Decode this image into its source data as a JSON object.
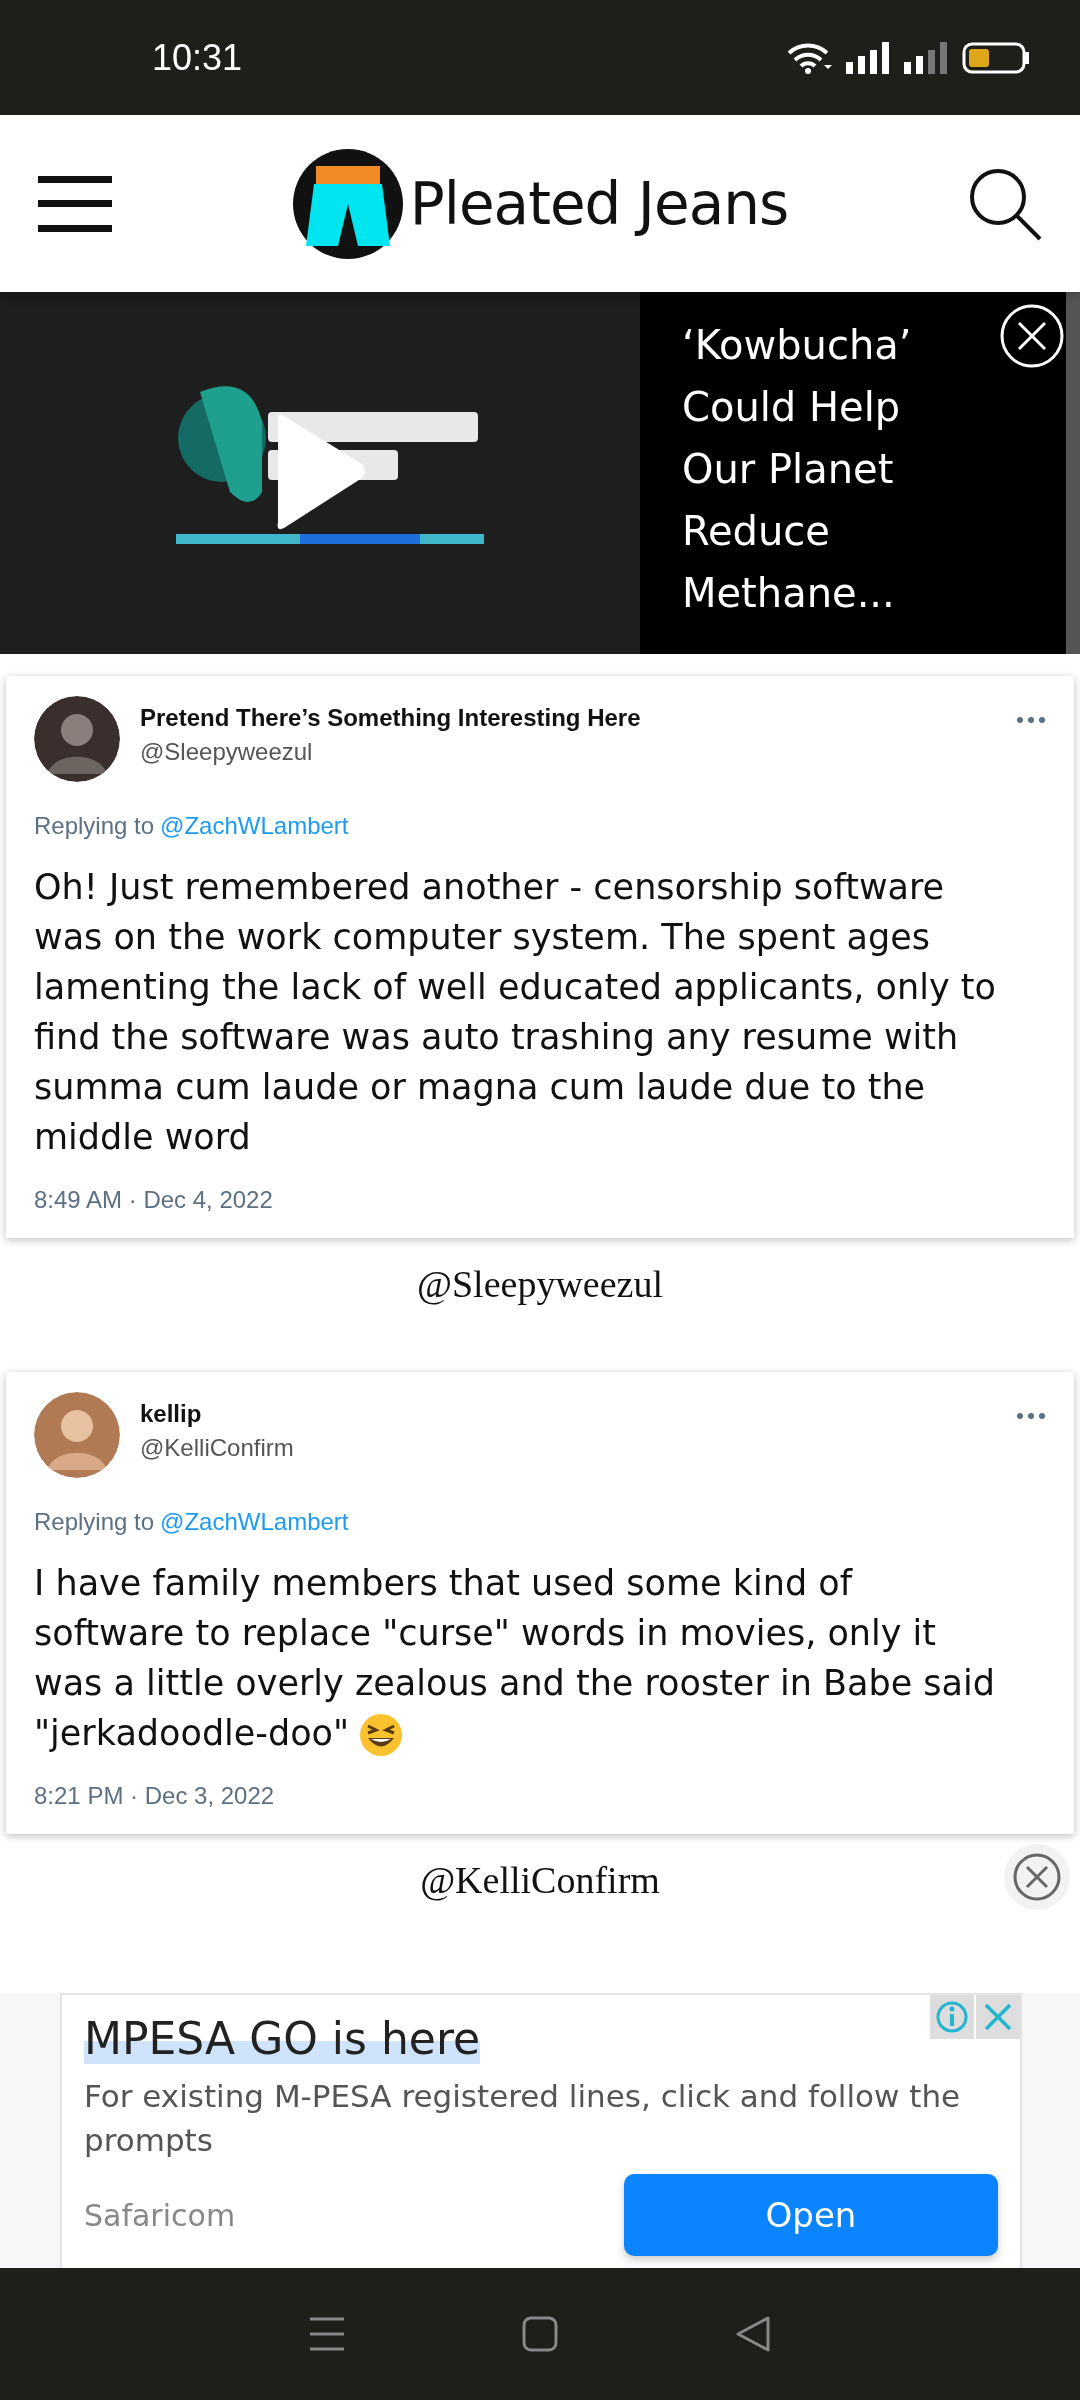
{
  "status_bar": {
    "time": "10:31"
  },
  "header": {
    "site_name": "Pleated Jeans"
  },
  "video": {
    "headline": "‘Kowbucha’ Could Help Our Planet Reduce Methane..."
  },
  "tweets": [
    {
      "name": "Pretend There’s Something Interesting Here",
      "handle": "@Sleepyweezul",
      "replying_label": "Replying to",
      "reply_to": "@ZachWLambert",
      "text": "Oh! Just remembered another - censorship software was on the work computer system. The spent ages lamenting the lack of well educated applicants, only to find the software was auto trashing any resume with summa cum laude or magna cum laude due to the middle word",
      "has_emoji": false,
      "timestamp": "8:49 AM · Dec 4, 2022",
      "caption": "@Sleepyweezul"
    },
    {
      "name": "kellip",
      "handle": "@KelliConfirm",
      "replying_label": "Replying to",
      "reply_to": "@ZachWLambert",
      "text": "I have family members that used some kind of software to replace \"curse\" words in movies, only it was a little overly zealous and the rooster in Babe said \"jerkadoodle-doo\"",
      "has_emoji": true,
      "timestamp": "8:21 PM · Dec 3, 2022",
      "caption": "@KelliConfirm"
    }
  ],
  "ad": {
    "title": "MPESA GO is here",
    "description": "For existing M-PESA registered lines, click and follow the prompts",
    "advertiser": "Safaricom",
    "button": "Open"
  }
}
